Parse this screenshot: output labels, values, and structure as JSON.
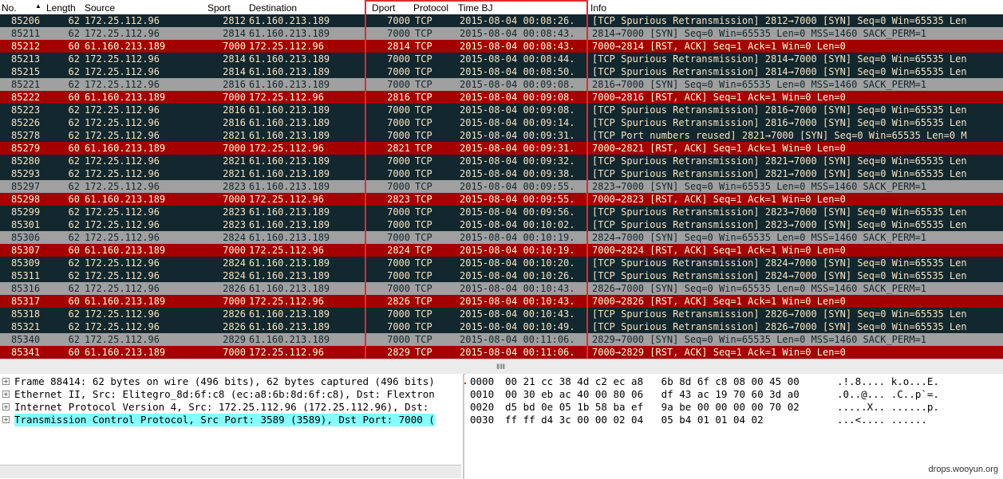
{
  "columns": {
    "no": "No.",
    "length": "Length",
    "source": "Source",
    "sport": "Sport",
    "destination": "Destination",
    "dport": "Dport",
    "protocol": "Protocol",
    "time": "Time BJ",
    "info": "Info"
  },
  "colors": {
    "dark_row_bg": "#12272e",
    "red_row_bg": "#a40000",
    "gray_row_bg": "#a0a0a0",
    "highlight_box": "#e22a2a",
    "selected_tree_bg": "#86ffff"
  },
  "packets": [
    {
      "style": "dark",
      "no": "85206",
      "length": "62",
      "source": "172.25.112.96",
      "sport": "2812",
      "destination": "61.160.213.189",
      "dport": "7000",
      "protocol": "TCP",
      "time": "2015-08-04  00:08:26.",
      "info": "[TCP Spurious Retransmission] 2812→7000 [SYN] Seq=0 Win=65535 Len"
    },
    {
      "style": "gray",
      "no": "85211",
      "length": "62",
      "source": "172.25.112.96",
      "sport": "2814",
      "destination": "61.160.213.189",
      "dport": "7000",
      "protocol": "TCP",
      "time": "2015-08-04  00:08:43.",
      "info": "2814→7000 [SYN] Seq=0 Win=65535 Len=0 MSS=1460 SACK_PERM=1"
    },
    {
      "style": "red",
      "no": "85212",
      "length": "60",
      "source": "61.160.213.189",
      "sport": "7000",
      "destination": "172.25.112.96",
      "dport": "2814",
      "protocol": "TCP",
      "time": "2015-08-04  00:08:43.",
      "info": "7000→2814 [RST, ACK] Seq=1 Ack=1 Win=0 Len=0"
    },
    {
      "style": "dark",
      "no": "85213",
      "length": "62",
      "source": "172.25.112.96",
      "sport": "2814",
      "destination": "61.160.213.189",
      "dport": "7000",
      "protocol": "TCP",
      "time": "2015-08-04  00:08:44.",
      "info": "[TCP Spurious Retransmission] 2814→7000 [SYN] Seq=0 Win=65535 Len"
    },
    {
      "style": "dark",
      "no": "85215",
      "length": "62",
      "source": "172.25.112.96",
      "sport": "2814",
      "destination": "61.160.213.189",
      "dport": "7000",
      "protocol": "TCP",
      "time": "2015-08-04  00:08:50.",
      "info": "[TCP Spurious Retransmission] 2814→7000 [SYN] Seq=0 Win=65535 Len"
    },
    {
      "style": "gray",
      "no": "85221",
      "length": "62",
      "source": "172.25.112.96",
      "sport": "2816",
      "destination": "61.160.213.189",
      "dport": "7000",
      "protocol": "TCP",
      "time": "2015-08-04  00:09:08.",
      "info": "2816→7000 [SYN] Seq=0 Win=65535 Len=0 MSS=1460 SACK_PERM=1"
    },
    {
      "style": "red",
      "no": "85222",
      "length": "60",
      "source": "61.160.213.189",
      "sport": "7000",
      "destination": "172.25.112.96",
      "dport": "2816",
      "protocol": "TCP",
      "time": "2015-08-04  00:09:08.",
      "info": "7000→2816 [RST, ACK] Seq=1 Ack=1 Win=0 Len=0"
    },
    {
      "style": "dark",
      "no": "85223",
      "length": "62",
      "source": "172.25.112.96",
      "sport": "2816",
      "destination": "61.160.213.189",
      "dport": "7000",
      "protocol": "TCP",
      "time": "2015-08-04  00:09:08.",
      "info": "[TCP Spurious Retransmission] 2816→7000 [SYN] Seq=0 Win=65535 Len"
    },
    {
      "style": "dark",
      "no": "85226",
      "length": "62",
      "source": "172.25.112.96",
      "sport": "2816",
      "destination": "61.160.213.189",
      "dport": "7000",
      "protocol": "TCP",
      "time": "2015-08-04  00:09:14.",
      "info": "[TCP Spurious Retransmission] 2816→7000 [SYN] Seq=0 Win=65535 Len"
    },
    {
      "style": "dark",
      "no": "85278",
      "length": "62",
      "source": "172.25.112.96",
      "sport": "2821",
      "destination": "61.160.213.189",
      "dport": "7000",
      "protocol": "TCP",
      "time": "2015-08-04  00:09:31.",
      "info": "[TCP Port numbers reused] 2821→7000 [SYN] Seq=0 Win=65535 Len=0 M"
    },
    {
      "style": "red",
      "no": "85279",
      "length": "60",
      "source": "61.160.213.189",
      "sport": "7000",
      "destination": "172.25.112.96",
      "dport": "2821",
      "protocol": "TCP",
      "time": "2015-08-04  00:09:31.",
      "info": "7000→2821 [RST, ACK] Seq=1 Ack=1 Win=0 Len=0"
    },
    {
      "style": "dark",
      "no": "85280",
      "length": "62",
      "source": "172.25.112.96",
      "sport": "2821",
      "destination": "61.160.213.189",
      "dport": "7000",
      "protocol": "TCP",
      "time": "2015-08-04  00:09:32.",
      "info": "[TCP Spurious Retransmission] 2821→7000 [SYN] Seq=0 Win=65535 Len"
    },
    {
      "style": "dark",
      "no": "85293",
      "length": "62",
      "source": "172.25.112.96",
      "sport": "2821",
      "destination": "61.160.213.189",
      "dport": "7000",
      "protocol": "TCP",
      "time": "2015-08-04  00:09:38.",
      "info": "[TCP Spurious Retransmission] 2821→7000 [SYN] Seq=0 Win=65535 Len"
    },
    {
      "style": "gray",
      "no": "85297",
      "length": "62",
      "source": "172.25.112.96",
      "sport": "2823",
      "destination": "61.160.213.189",
      "dport": "7000",
      "protocol": "TCP",
      "time": "2015-08-04  00:09:55.",
      "info": "2823→7000 [SYN] Seq=0 Win=65535 Len=0 MSS=1460 SACK_PERM=1"
    },
    {
      "style": "red",
      "no": "85298",
      "length": "60",
      "source": "61.160.213.189",
      "sport": "7000",
      "destination": "172.25.112.96",
      "dport": "2823",
      "protocol": "TCP",
      "time": "2015-08-04  00:09:55.",
      "info": "7000→2823 [RST, ACK] Seq=1 Ack=1 Win=0 Len=0"
    },
    {
      "style": "dark",
      "no": "85299",
      "length": "62",
      "source": "172.25.112.96",
      "sport": "2823",
      "destination": "61.160.213.189",
      "dport": "7000",
      "protocol": "TCP",
      "time": "2015-08-04  00:09:56.",
      "info": "[TCP Spurious Retransmission] 2823→7000 [SYN] Seq=0 Win=65535 Len"
    },
    {
      "style": "dark",
      "no": "85301",
      "length": "62",
      "source": "172.25.112.96",
      "sport": "2823",
      "destination": "61.160.213.189",
      "dport": "7000",
      "protocol": "TCP",
      "time": "2015-08-04  00:10:02.",
      "info": "[TCP Spurious Retransmission] 2823→7000 [SYN] Seq=0 Win=65535 Len"
    },
    {
      "style": "gray",
      "no": "85306",
      "length": "62",
      "source": "172.25.112.96",
      "sport": "2824",
      "destination": "61.160.213.189",
      "dport": "7000",
      "protocol": "TCP",
      "time": "2015-08-04  00:10:19.",
      "info": "2824→7000 [SYN] Seq=0 Win=65535 Len=0 MSS=1460 SACK_PERM=1"
    },
    {
      "style": "red",
      "no": "85307",
      "length": "60",
      "source": "61.160.213.189",
      "sport": "7000",
      "destination": "172.25.112.96",
      "dport": "2824",
      "protocol": "TCP",
      "time": "2015-08-04  00:10:19.",
      "info": "7000→2824 [RST, ACK] Seq=1 Ack=1 Win=0 Len=0"
    },
    {
      "style": "dark",
      "no": "85309",
      "length": "62",
      "source": "172.25.112.96",
      "sport": "2824",
      "destination": "61.160.213.189",
      "dport": "7000",
      "protocol": "TCP",
      "time": "2015-08-04  00:10:20.",
      "info": "[TCP Spurious Retransmission] 2824→7000 [SYN] Seq=0 Win=65535 Len"
    },
    {
      "style": "dark",
      "no": "85311",
      "length": "62",
      "source": "172.25.112.96",
      "sport": "2824",
      "destination": "61.160.213.189",
      "dport": "7000",
      "protocol": "TCP",
      "time": "2015-08-04  00:10:26.",
      "info": "[TCP Spurious Retransmission] 2824→7000 [SYN] Seq=0 Win=65535 Len"
    },
    {
      "style": "gray",
      "no": "85316",
      "length": "62",
      "source": "172.25.112.96",
      "sport": "2826",
      "destination": "61.160.213.189",
      "dport": "7000",
      "protocol": "TCP",
      "time": "2015-08-04  00:10:43.",
      "info": "2826→7000 [SYN] Seq=0 Win=65535 Len=0 MSS=1460 SACK_PERM=1"
    },
    {
      "style": "red",
      "no": "85317",
      "length": "60",
      "source": "61.160.213.189",
      "sport": "7000",
      "destination": "172.25.112.96",
      "dport": "2826",
      "protocol": "TCP",
      "time": "2015-08-04  00:10:43.",
      "info": "7000→2826 [RST, ACK] Seq=1 Ack=1 Win=0 Len=0"
    },
    {
      "style": "dark",
      "no": "85318",
      "length": "62",
      "source": "172.25.112.96",
      "sport": "2826",
      "destination": "61.160.213.189",
      "dport": "7000",
      "protocol": "TCP",
      "time": "2015-08-04  00:10:43.",
      "info": "[TCP Spurious Retransmission] 2826→7000 [SYN] Seq=0 Win=65535 Len"
    },
    {
      "style": "dark",
      "no": "85321",
      "length": "62",
      "source": "172.25.112.96",
      "sport": "2826",
      "destination": "61.160.213.189",
      "dport": "7000",
      "protocol": "TCP",
      "time": "2015-08-04  00:10:49.",
      "info": "[TCP Spurious Retransmission] 2826→7000 [SYN] Seq=0 Win=65535 Len"
    },
    {
      "style": "gray",
      "no": "85340",
      "length": "62",
      "source": "172.25.112.96",
      "sport": "2829",
      "destination": "61.160.213.189",
      "dport": "7000",
      "protocol": "TCP",
      "time": "2015-08-04  00:11:06.",
      "info": "2829→7000 [SYN] Seq=0 Win=65535 Len=0 MSS=1460 SACK_PERM=1"
    },
    {
      "style": "red",
      "no": "85341",
      "length": "60",
      "source": "61.160.213.189",
      "sport": "7000",
      "destination": "172.25.112.96",
      "dport": "2829",
      "protocol": "TCP",
      "time": "2015-08-04  00:11:06.",
      "info": "7000→2829 [RST, ACK] Seq=1 Ack=1 Win=0 Len=0"
    }
  ],
  "details": [
    {
      "text": "Frame 88414: 62 bytes on wire (496 bits), 62 bytes captured (496 bits)",
      "selected": false
    },
    {
      "text": "Ethernet II, Src: Elitegro_8d:6f:c8 (ec:a8:6b:8d:6f:c8), Dst: Flextron",
      "selected": false
    },
    {
      "text": "Internet Protocol Version 4, Src: 172.25.112.96 (172.25.112.96), Dst: ",
      "selected": false
    },
    {
      "text": "Transmission Control Protocol, Src Port: 3589 (3589), Dst Port: 7000 (",
      "selected": true
    }
  ],
  "bytes": [
    {
      "offset": "0000",
      "hex": "00 21 cc 38 4d c2 ec a8   6b 8d 6f c8 08 00 45 00",
      "ascii": ".!.8.... k.o...E."
    },
    {
      "offset": "0010",
      "hex": "00 30 eb ac 40 00 80 06   df 43 ac 19 70 60 3d a0",
      "ascii": ".0..@... .C..p`=."
    },
    {
      "offset": "0020",
      "hex": "d5 bd 0e 05 1b 58 ba ef   9a be 00 00 00 00 70 02",
      "ascii": ".....X.. ......p."
    },
    {
      "offset": "0030",
      "hex": "ff ff d4 3c 00 00 02 04   05 b4 01 01 04 02",
      "ascii": "...<.... ......"
    }
  ],
  "scrollbar": {
    "grip": "‖‖‖"
  },
  "watermark": "drops.wooyun.org",
  "icons": {
    "sort": "sort-ascending-icon",
    "expand": "tree-expand-icon"
  }
}
